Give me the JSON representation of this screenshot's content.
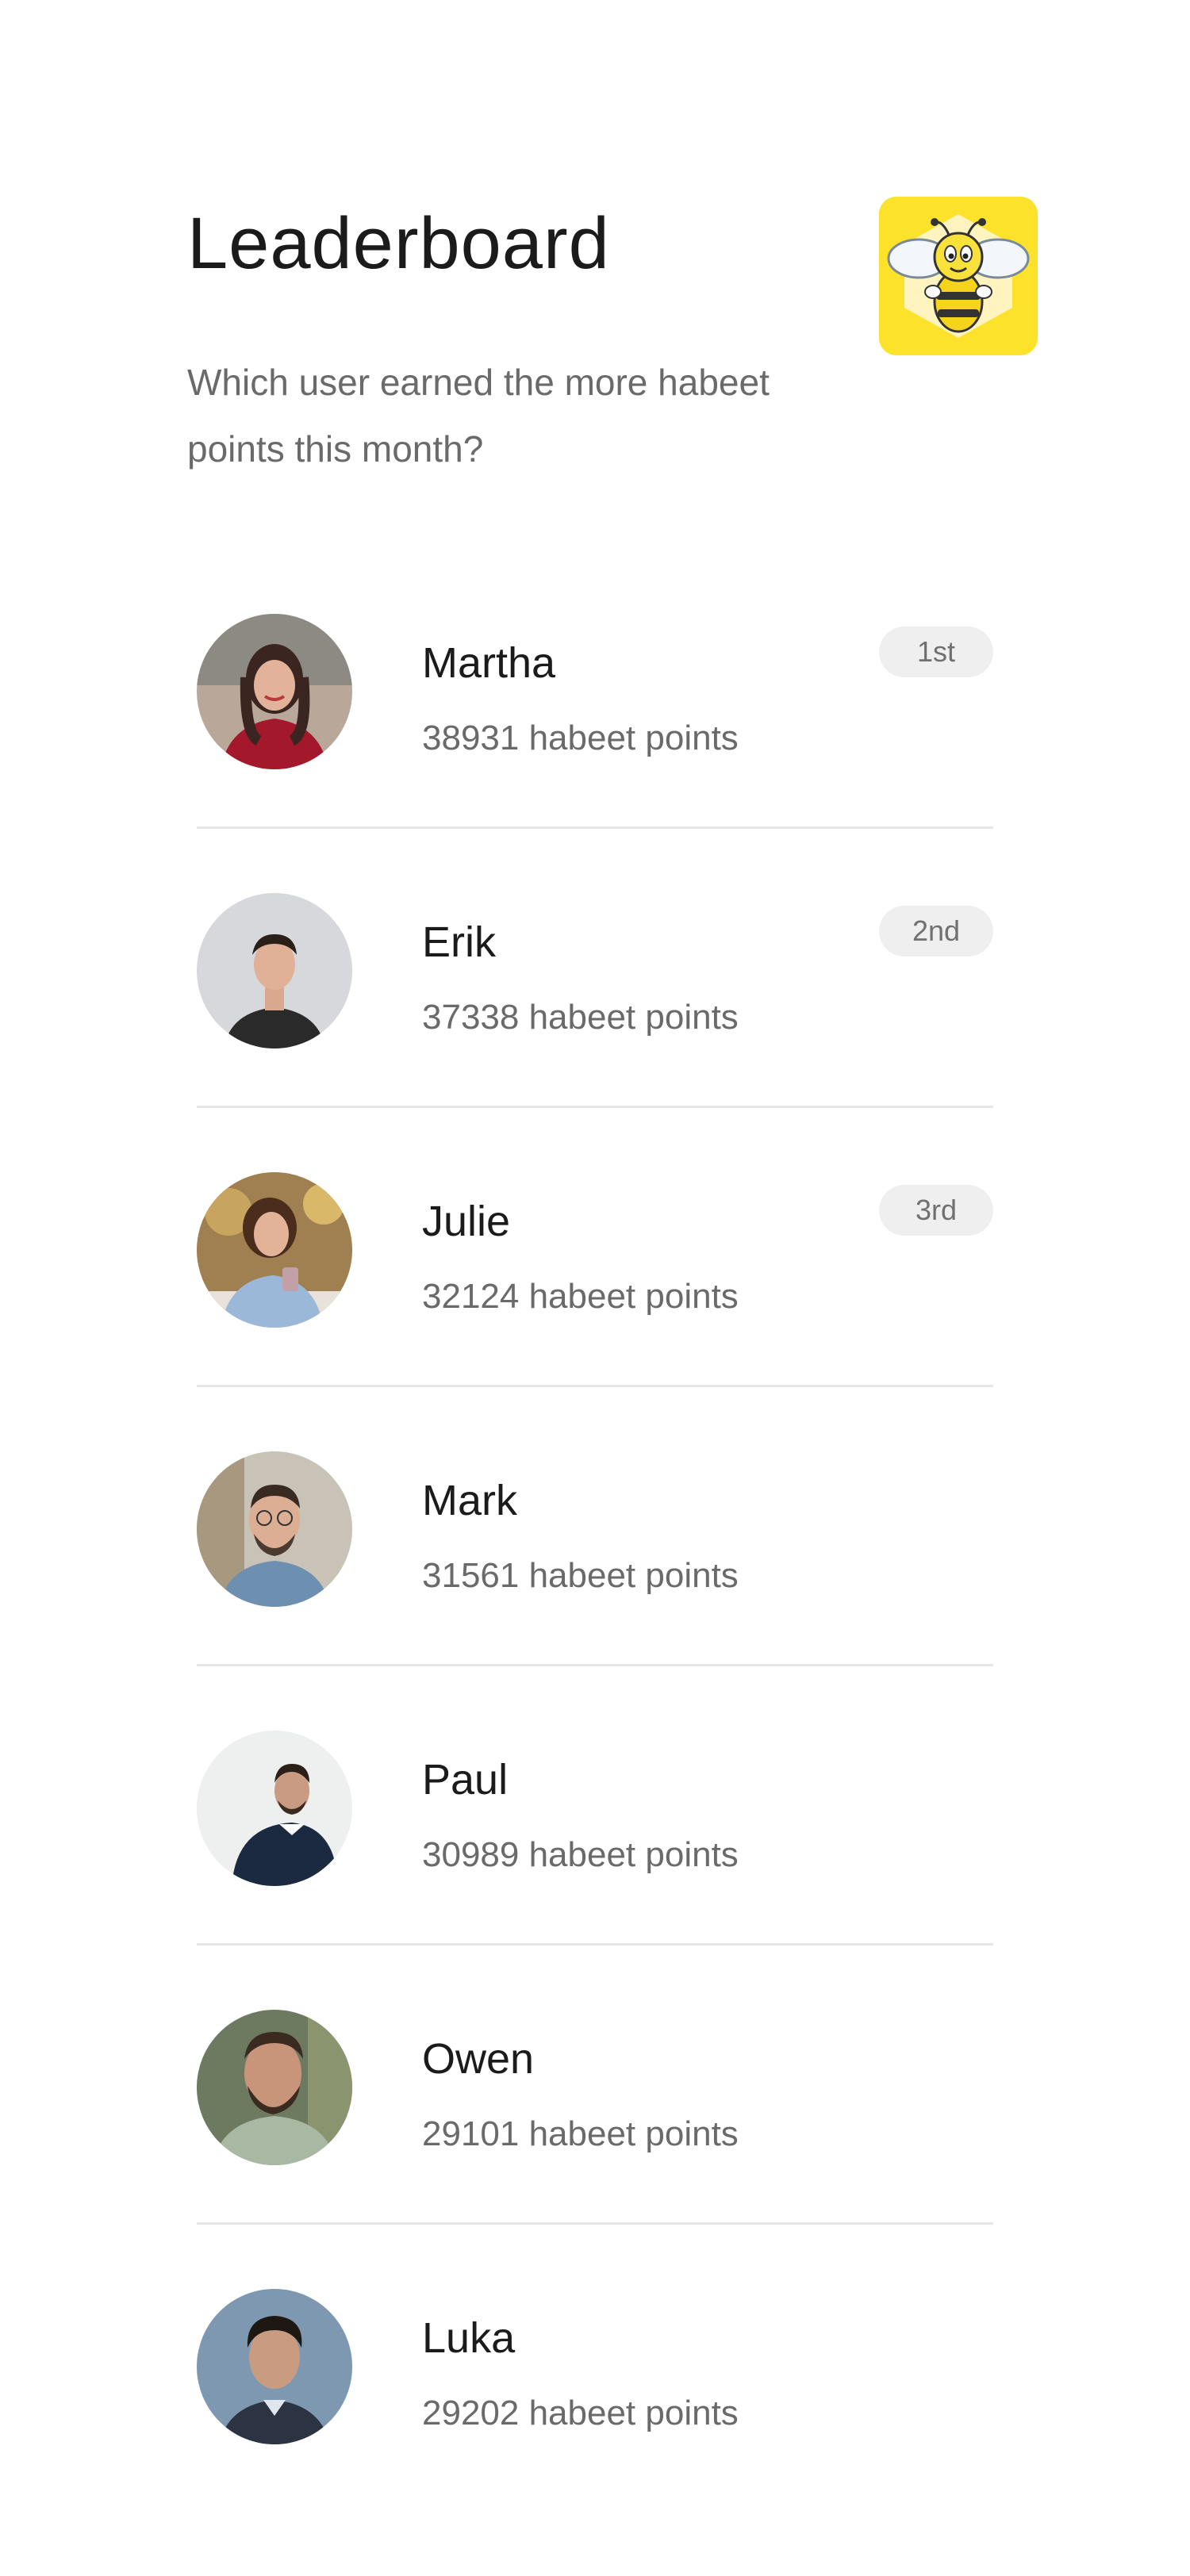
{
  "header": {
    "title": "Leaderboard",
    "subtitle": "Which user earned the more habeet points this month?",
    "logo_icon": "bee-mascot-icon"
  },
  "colors": {
    "logo_background": "#fce22a",
    "badge_background": "#efefef",
    "divider": "#e6e6e6",
    "secondary_text": "#6a6a6a"
  },
  "users": [
    {
      "name": "Martha",
      "points": "38931 habeet points",
      "rank": "1st"
    },
    {
      "name": "Erik",
      "points": "37338 habeet points",
      "rank": "2nd"
    },
    {
      "name": "Julie",
      "points": "32124 habeet points",
      "rank": "3rd"
    },
    {
      "name": "Mark",
      "points": "31561 habeet points"
    },
    {
      "name": "Paul",
      "points": "30989 habeet points"
    },
    {
      "name": "Owen",
      "points": "29101 habeet points"
    },
    {
      "name": "Luka",
      "points": "29202 habeet points"
    }
  ]
}
